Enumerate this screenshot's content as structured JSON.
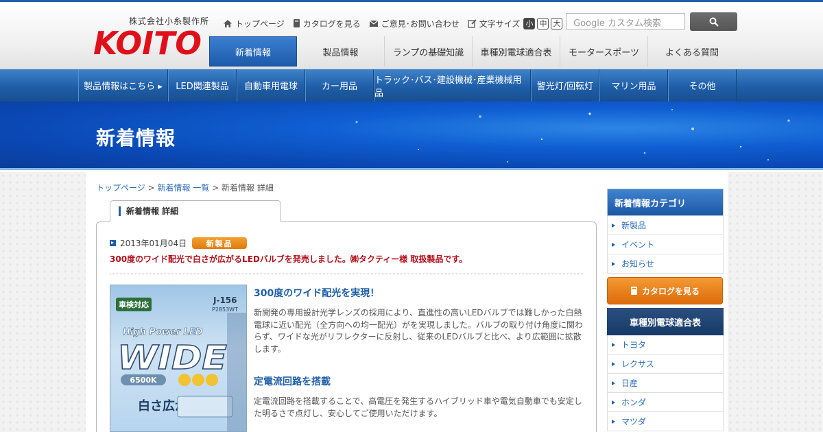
{
  "header": {
    "company_name": "株式会社小糸製作所",
    "logo_text": "KOITO",
    "util_links": [
      {
        "label": "トップページ",
        "icon": "home-icon"
      },
      {
        "label": "カタログを見る",
        "icon": "book-icon"
      },
      {
        "label": "ご意見･お問い合わせ",
        "icon": "mail-icon"
      },
      {
        "label": "文字サイズ",
        "icon": "edit-icon"
      }
    ],
    "font_sizes": [
      "小",
      "中",
      "大"
    ],
    "search_placeholder": "Google カスタム検索",
    "main_nav": [
      "新着情報",
      "製品情報",
      "ランプの基礎知識",
      "車種別電球適合表",
      "モータースポーツ",
      "よくある質問"
    ],
    "active_nav": "新着情報"
  },
  "product_nav": [
    "製品情報はこちら ▸",
    "LED関連製品",
    "自動車用電球",
    "カー用品",
    "トラック･バス･建設機械･産業機械用品",
    "警光灯/回転灯",
    "マリン用品",
    "その他"
  ],
  "banner": {
    "title": "新着情報"
  },
  "breadcrumb": {
    "home": "トップページ",
    "list": "新着情報 一覧",
    "current": "新着情報 詳細",
    "sep": ">"
  },
  "article": {
    "tab_label": "新着情報 詳細",
    "date": "2013年01月04日",
    "badge": "新製品",
    "headline": "300度のワイド配光で白さが広がるLEDバルブを発売しました。㈱タクティー様 取扱製品です。",
    "section1_title": "300度のワイド配光を実現！",
    "section1_text": "新開発の専用設計光学レンズの採用により、直進性の高いLEDバルブでは難しかった白熱電球に近い配光（全方向への均一配光）がを実現しました。バルブの取り付け角度に関わらず、ワイドな光がリフレクターに反射し、従来のLEDバルブと比べ、より広範囲に拡散します。",
    "section2_title": "定電流回路を搭載",
    "section2_text": "定電流回路を搭載することで、高電圧を発生するハイブリッド車や電気自動車でも安定した明るさで点灯し、安心してご使用いただけます。",
    "product_image": {
      "badge": "車検対応",
      "code": "J-156",
      "subcode": "P2853WT",
      "line1": "High Power LED",
      "line2": "WIDE",
      "kelvin": "6500K",
      "catch": "白さ広がる"
    }
  },
  "sidebar": {
    "category_title": "新着情報カテゴリ",
    "categories": [
      "新製品",
      "イベント",
      "お知らせ"
    ],
    "catalog_button": "カタログを見る",
    "bulb_title": "車種別電球適合表",
    "makers": [
      "トヨタ",
      "レクサス",
      "日産",
      "ホンダ",
      "マツダ"
    ]
  },
  "colors": {
    "brand_red": "#e0101b",
    "brand_blue": "#1f5fa8",
    "badge_orange": "#e67e12",
    "headline_red": "#b1101a"
  }
}
